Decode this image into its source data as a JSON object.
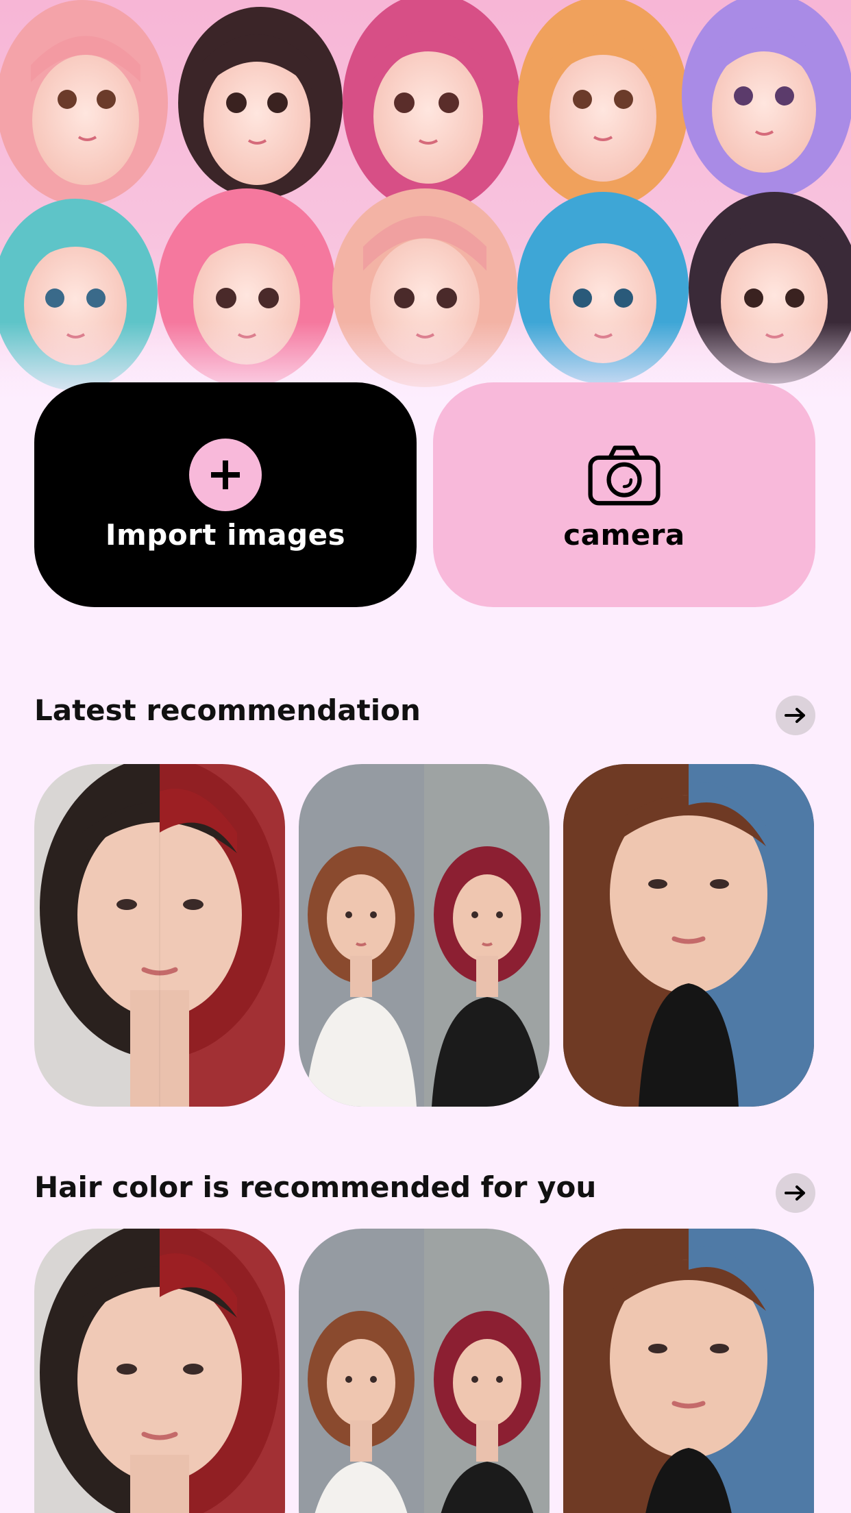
{
  "buttons": {
    "import_label": "Import images",
    "camera_label": "camera"
  },
  "sections": [
    {
      "title": "Latest recommendation"
    },
    {
      "title": "Hair color is recommended for you"
    }
  ],
  "colors": {
    "background": "#fdeefe",
    "accent_pink": "#f8b9da",
    "import_button": "#000000"
  },
  "icons": {
    "import": "plus-icon",
    "camera": "camera-icon",
    "section_more": "arrow-right-icon"
  }
}
